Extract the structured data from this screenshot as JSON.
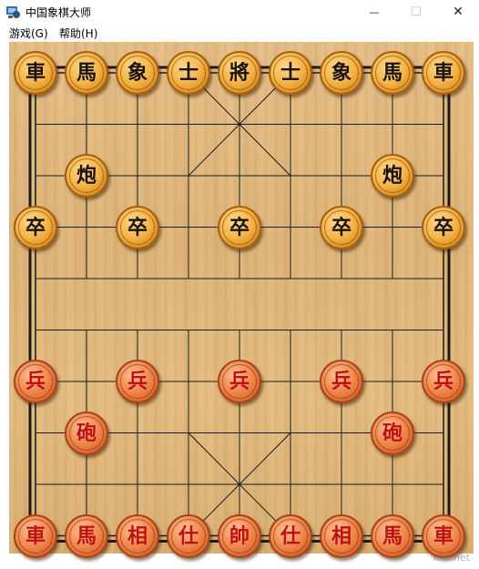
{
  "window": {
    "title": "中国象棋大师",
    "minimize_glyph": "—",
    "maximize_glyph": "☐",
    "close_glyph": "✕"
  },
  "menu": {
    "items": [
      {
        "label": "游戏(G)"
      },
      {
        "label": "帮助(H)"
      }
    ]
  },
  "board": {
    "columns": 9,
    "rows": 10,
    "wood_color": "#e6bf86",
    "line_color": "#1a1a1a"
  },
  "pieces": [
    {
      "side": "black",
      "char": "車",
      "col": 0,
      "row": 0
    },
    {
      "side": "black",
      "char": "馬",
      "col": 1,
      "row": 0
    },
    {
      "side": "black",
      "char": "象",
      "col": 2,
      "row": 0
    },
    {
      "side": "black",
      "char": "士",
      "col": 3,
      "row": 0
    },
    {
      "side": "black",
      "char": "將",
      "col": 4,
      "row": 0
    },
    {
      "side": "black",
      "char": "士",
      "col": 5,
      "row": 0
    },
    {
      "side": "black",
      "char": "象",
      "col": 6,
      "row": 0
    },
    {
      "side": "black",
      "char": "馬",
      "col": 7,
      "row": 0
    },
    {
      "side": "black",
      "char": "車",
      "col": 8,
      "row": 0
    },
    {
      "side": "black",
      "char": "炮",
      "col": 1,
      "row": 2
    },
    {
      "side": "black",
      "char": "炮",
      "col": 7,
      "row": 2
    },
    {
      "side": "black",
      "char": "卒",
      "col": 0,
      "row": 3
    },
    {
      "side": "black",
      "char": "卒",
      "col": 2,
      "row": 3
    },
    {
      "side": "black",
      "char": "卒",
      "col": 4,
      "row": 3
    },
    {
      "side": "black",
      "char": "卒",
      "col": 6,
      "row": 3
    },
    {
      "side": "black",
      "char": "卒",
      "col": 8,
      "row": 3
    },
    {
      "side": "red",
      "char": "兵",
      "col": 0,
      "row": 6
    },
    {
      "side": "red",
      "char": "兵",
      "col": 2,
      "row": 6
    },
    {
      "side": "red",
      "char": "兵",
      "col": 4,
      "row": 6
    },
    {
      "side": "red",
      "char": "兵",
      "col": 6,
      "row": 6
    },
    {
      "side": "red",
      "char": "兵",
      "col": 8,
      "row": 6
    },
    {
      "side": "red",
      "char": "砲",
      "col": 1,
      "row": 7
    },
    {
      "side": "red",
      "char": "砲",
      "col": 7,
      "row": 7
    },
    {
      "side": "red",
      "char": "車",
      "col": 0,
      "row": 9
    },
    {
      "side": "red",
      "char": "馬",
      "col": 1,
      "row": 9
    },
    {
      "side": "red",
      "char": "相",
      "col": 2,
      "row": 9
    },
    {
      "side": "red",
      "char": "仕",
      "col": 3,
      "row": 9
    },
    {
      "side": "red",
      "char": "帥",
      "col": 4,
      "row": 9
    },
    {
      "side": "red",
      "char": "仕",
      "col": 5,
      "row": 9
    },
    {
      "side": "red",
      "char": "相",
      "col": 6,
      "row": 9
    },
    {
      "side": "red",
      "char": "馬",
      "col": 7,
      "row": 9
    },
    {
      "side": "red",
      "char": "車",
      "col": 8,
      "row": 9
    }
  ],
  "watermark": "kkx.net"
}
